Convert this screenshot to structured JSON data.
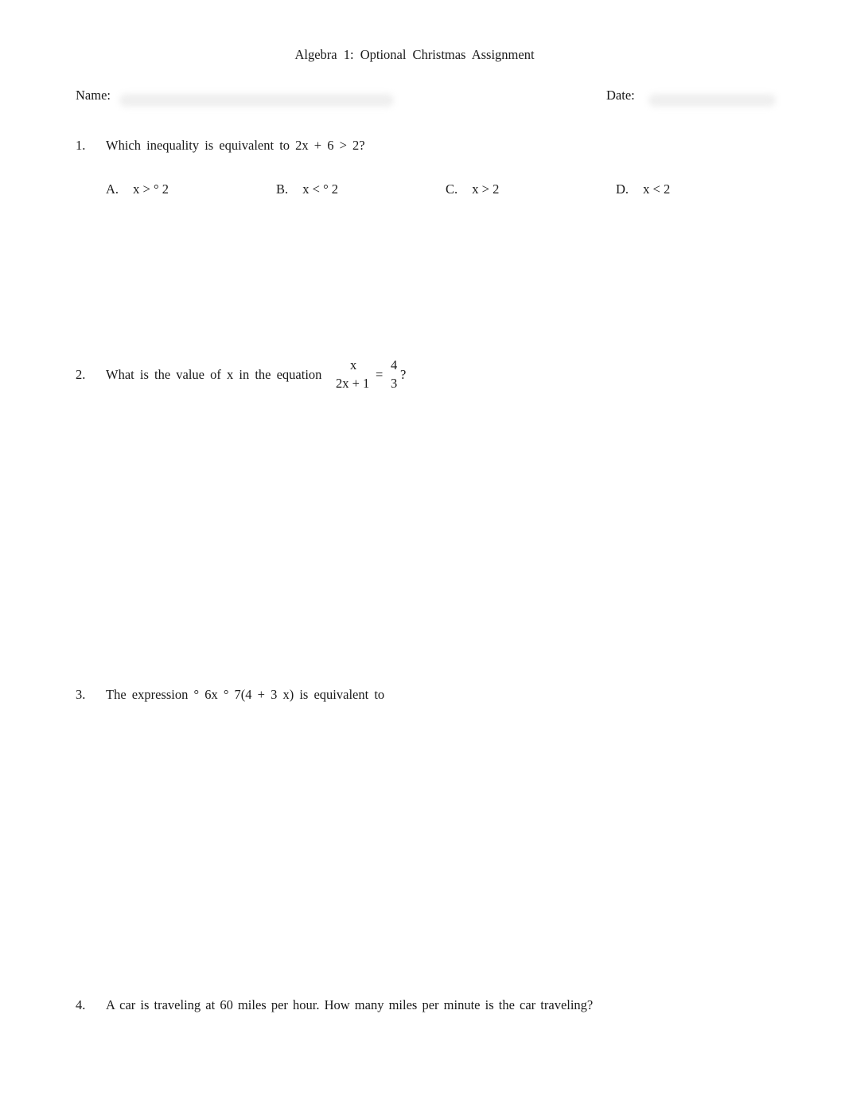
{
  "header": {
    "title": "Algebra 1: Optional Christmas Assignment",
    "name_label": "Name:",
    "name_value": "",
    "date_label": "Date:",
    "date_value": ""
  },
  "questions": [
    {
      "number": "1.",
      "text": "Which inequality is equivalent to 2x + 6 > 2?",
      "choices": [
        {
          "letter": "A.",
          "text": "x > ° 2"
        },
        {
          "letter": "B.",
          "text": "x < ° 2"
        },
        {
          "letter": "C.",
          "text": "x > 2"
        },
        {
          "letter": "D.",
          "text": "x < 2"
        }
      ]
    },
    {
      "number": "2.",
      "text": "What is the value of x in the equation",
      "equation": {
        "left_numerator": "x",
        "left_denominator": "2x + 1",
        "equals": "=",
        "right_numerator": "4",
        "right_denominator": "3",
        "end": "?"
      }
    },
    {
      "number": "3.",
      "text": "The expression ° 6x °  7(4 + 3 x) is equivalent to"
    },
    {
      "number": "4.",
      "text": "A car is traveling at 60 miles per hour. How many miles per minute is the car traveling?"
    }
  ]
}
